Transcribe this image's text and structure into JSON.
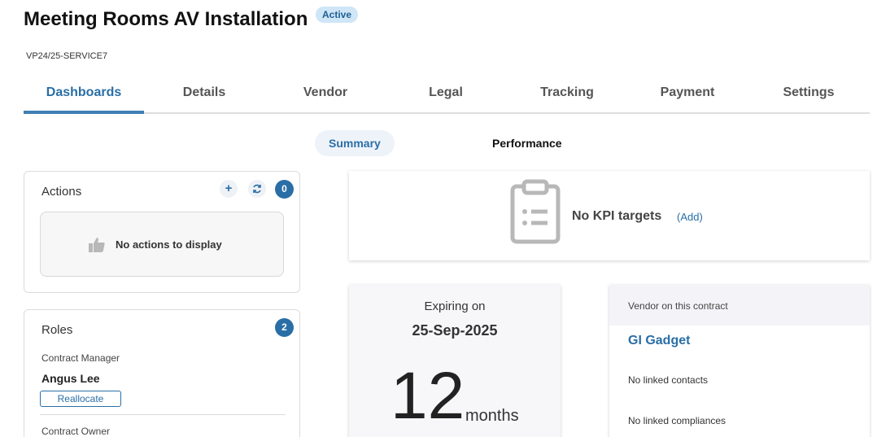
{
  "header": {
    "title": "Meeting Rooms AV Installation",
    "status": "Active",
    "code": "VP24/25-SERVICE7"
  },
  "tabs": [
    {
      "label": "Dashboards"
    },
    {
      "label": "Details"
    },
    {
      "label": "Vendor"
    },
    {
      "label": "Legal"
    },
    {
      "label": "Tracking"
    },
    {
      "label": "Payment"
    },
    {
      "label": "Settings"
    }
  ],
  "subtabs": [
    {
      "label": "Summary"
    },
    {
      "label": "Performance"
    }
  ],
  "actions": {
    "title": "Actions",
    "count": "0",
    "empty_text": "No actions to display"
  },
  "roles": {
    "title": "Roles",
    "count": "2",
    "manager_label": "Contract Manager",
    "manager_name": "Angus Lee",
    "reallocate_label": "Reallocate",
    "owner_label": "Contract Owner"
  },
  "kpi": {
    "text": "No KPI targets",
    "add_label": "(Add)"
  },
  "expiry": {
    "label": "Expiring on",
    "date": "25-Sep-2025",
    "remaining_value": "12",
    "remaining_unit": "months"
  },
  "vendor": {
    "header": "Vendor on this contract",
    "name": "GI Gadget",
    "contacts": "No linked contacts",
    "compliances": "No linked compliances"
  },
  "colors": {
    "accent": "#2a6ea6",
    "badge_bg": "#cfe6f7"
  }
}
